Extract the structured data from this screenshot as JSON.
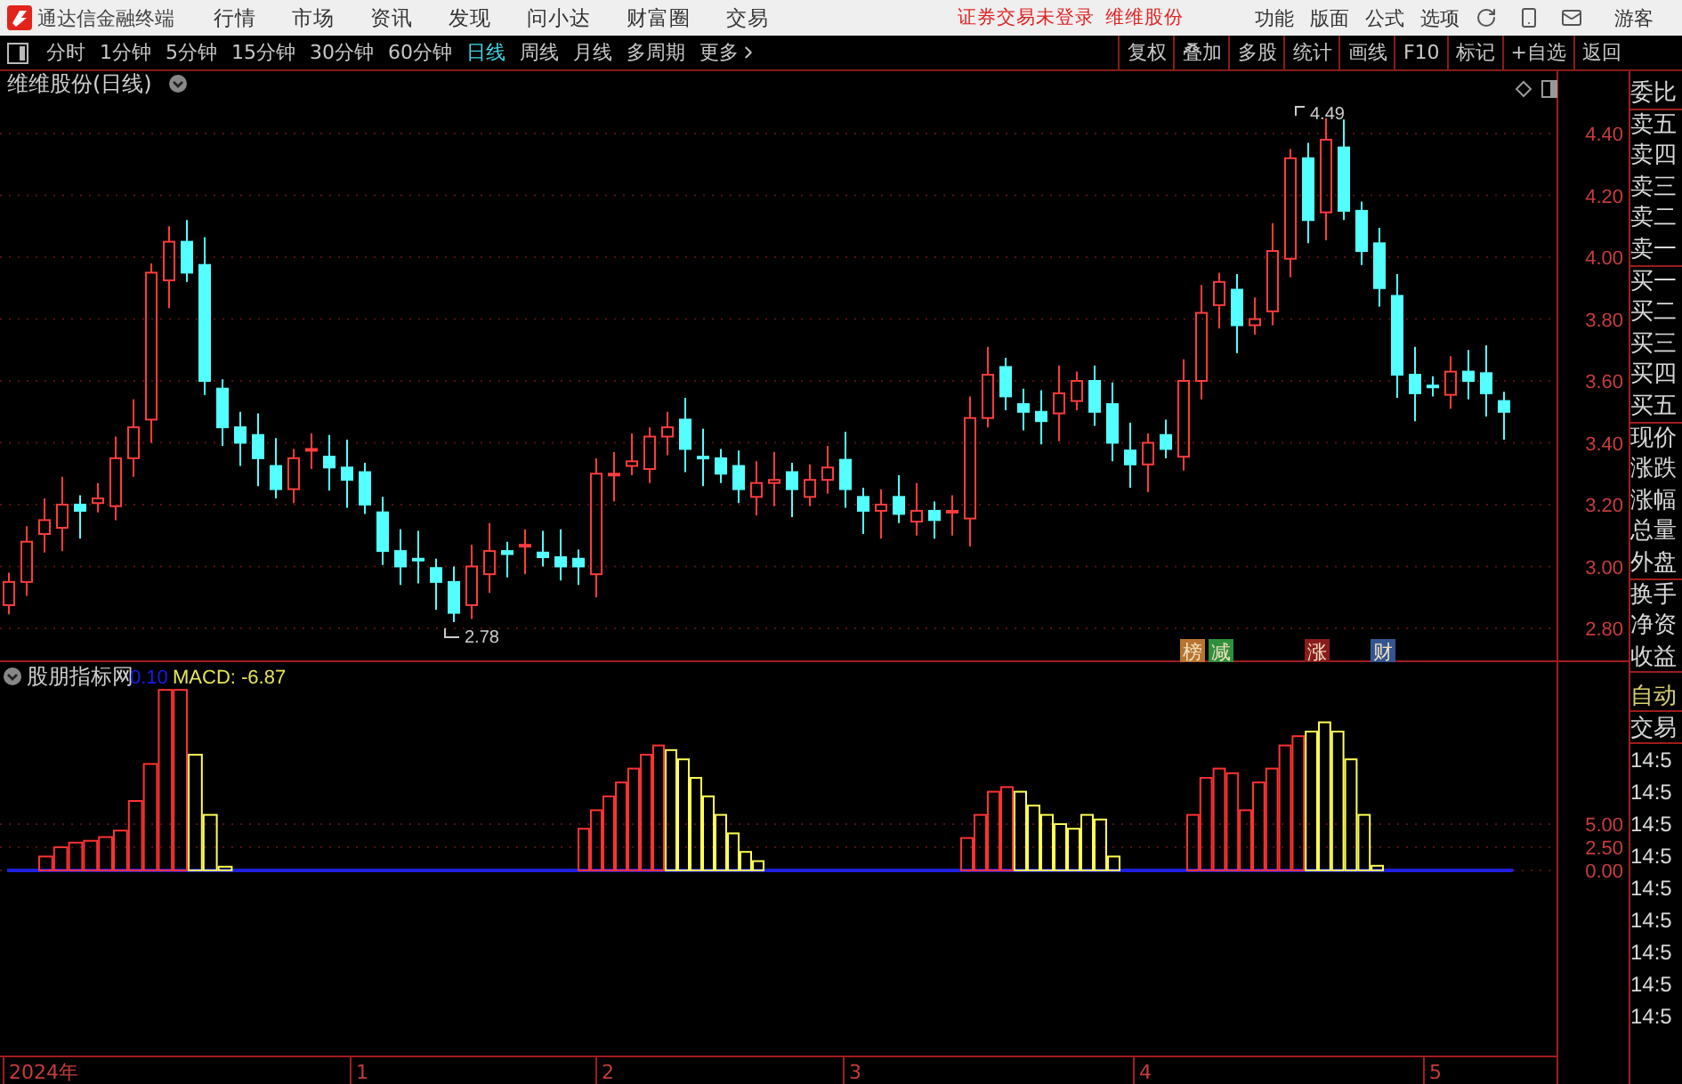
{
  "app": {
    "title": "通达信金融终端",
    "menus": [
      "行情",
      "市场",
      "资讯",
      "发现",
      "问小达",
      "财富圈",
      "交易"
    ],
    "status": "证券交易未登录",
    "stock": "维维股份",
    "functions": [
      "功能",
      "版面",
      "公式",
      "选项"
    ],
    "user": "游客"
  },
  "period_tabs": [
    {
      "label": "分时",
      "selected": false
    },
    {
      "label": "1分钟",
      "selected": false
    },
    {
      "label": "5分钟",
      "selected": false
    },
    {
      "label": "15分钟",
      "selected": false
    },
    {
      "label": "30分钟",
      "selected": false
    },
    {
      "label": "60分钟",
      "selected": false
    },
    {
      "label": "日线",
      "selected": true
    },
    {
      "label": "周线",
      "selected": false
    },
    {
      "label": "月线",
      "selected": false
    },
    {
      "label": "多周期",
      "selected": false
    },
    {
      "label": "更多",
      "selected": false
    }
  ],
  "tool_buttons": [
    "复权",
    "叠加",
    "多股",
    "统计",
    "画线",
    "F10",
    "标记",
    "+自选",
    "返回"
  ],
  "price_chart": {
    "title": "维维股份(日线)",
    "yticks": [
      "4.40",
      "4.20",
      "4.00",
      "3.80",
      "3.60",
      "3.40",
      "3.20",
      "3.00",
      "2.80"
    ],
    "high_label": "4.49",
    "low_label": "2.78",
    "markers": [
      {
        "label": "榜",
        "color": "#b8742e"
      },
      {
        "label": "减",
        "color": "#2f8f3a"
      },
      {
        "label": "涨",
        "color": "#8a1c1c"
      },
      {
        "label": "财",
        "color": "#34558f"
      }
    ]
  },
  "indicator": {
    "name": "股朋指标网",
    "param": "0.10",
    "value": "MACD: -6.87",
    "yticks": [
      "5.00",
      "2.50",
      "0.00"
    ]
  },
  "x_axis": [
    "2024年",
    "1",
    "2",
    "3",
    "4",
    "5"
  ],
  "side_panel": {
    "quote_labels": [
      "委比",
      "卖五",
      "卖四",
      "卖三",
      "卖二",
      "卖一",
      "买一",
      "买二",
      "买三",
      "买四",
      "买五",
      "现价",
      "涨跌",
      "涨幅",
      "总量",
      "外盘",
      "换手",
      "净资",
      "收益"
    ],
    "mode": "自动",
    "trade": "交易",
    "times": [
      "14:5",
      "14:5",
      "14:5",
      "14:5",
      "14:5",
      "14:5",
      "14:5",
      "14:5",
      "14:5"
    ]
  }
}
